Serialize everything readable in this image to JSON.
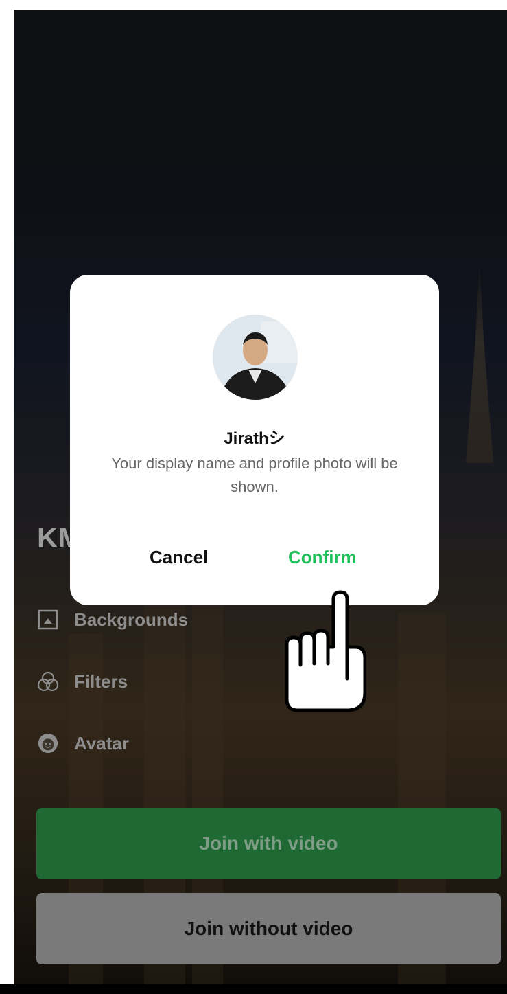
{
  "meeting": {
    "title_partial": "KM"
  },
  "options": [
    {
      "label": "Backgrounds",
      "icon": "image-icon"
    },
    {
      "label": "Filters",
      "icon": "filters-icon"
    },
    {
      "label": "Avatar",
      "icon": "avatar-face-icon"
    }
  ],
  "buttons": {
    "join_with_video": "Join with video",
    "join_without_video": "Join without video"
  },
  "dialog": {
    "name": "Jirathシ",
    "message": "Your display name and profile photo will be shown.",
    "cancel": "Cancel",
    "confirm": "Confirm"
  },
  "colors": {
    "confirm": "#1ec05a",
    "join_video_bg": "#1f6a34"
  },
  "overlay": {
    "hand": "tap-hand-icon"
  }
}
